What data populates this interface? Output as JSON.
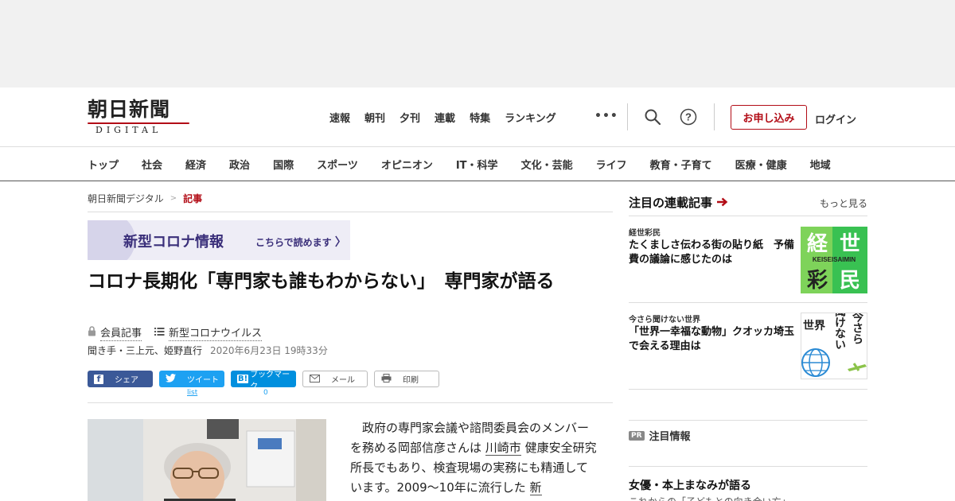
{
  "logo": {
    "main": "朝日新聞",
    "sub": "DIGITAL"
  },
  "topnav": [
    "速報",
    "朝刊",
    "夕刊",
    "連載",
    "特集",
    "ランキング"
  ],
  "header": {
    "more": "•••",
    "apply_label": "お申し込み",
    "login_label": "ログイン"
  },
  "categories": [
    "トップ",
    "社会",
    "経済",
    "政治",
    "国際",
    "スポーツ",
    "オピニオン",
    "IT・科学",
    "文化・芸能",
    "ライフ",
    "教育・子育て",
    "医療・健康",
    "地域"
  ],
  "breadcrumb": {
    "home": "朝日新聞デジタル",
    "sep": ">",
    "current": "記事"
  },
  "banner": {
    "title": "新型コロナ情報",
    "cta": "こちらで読めます"
  },
  "article": {
    "title": "コロナ長期化「専門家も誰もわからない」　専門家が語る",
    "member": "会員記事",
    "topic": "新型コロナウイルス",
    "byline": "聞き手・三上元、姫野直行",
    "date": "2020年6月23日 19時33分",
    "body_1": "政府の専門家会議や諮問委員会のメンバーを務める岡部信彦さんは",
    "body_link1": "川崎市",
    "body_2": "健康安全研究所長でもあり、検査現場の実務にも精通しています。2009～10年に流行した",
    "body_link2": "新"
  },
  "share": {
    "facebook": "シェア",
    "twitter": "ツイート",
    "hatena": "ブックマーク",
    "mail": "メール",
    "print": "印刷",
    "twitter_count": "list",
    "hatena_count": "0"
  },
  "sidebar": {
    "heading": "注目の連載記事",
    "more": "もっと見る",
    "items": [
      {
        "label": "経世彩民",
        "title": "たくましさ伝わる街の貼り紙　予備費の議論に感じたのは",
        "thumb_text": [
          "経",
          "世",
          "彩",
          "民"
        ],
        "thumb_sub": "KEISEISAIMIN"
      },
      {
        "label": "今さら聞けない世界",
        "title": "「世界一幸福な動物」クオッカ埼玉で会える理由は",
        "thumb_text": [
          "今さら",
          "聞けない",
          "世界"
        ]
      }
    ],
    "pr_badge": "PR",
    "pr_heading": "注目情報",
    "pr_title": "女優・本上まなみが語る",
    "pr_sub": "これからの「子どもとの向き合い方」"
  },
  "colors": {
    "accent": "#b20c16",
    "facebook": "#3b5998",
    "twitter": "#1da1f2",
    "hatena": "#008fde"
  }
}
